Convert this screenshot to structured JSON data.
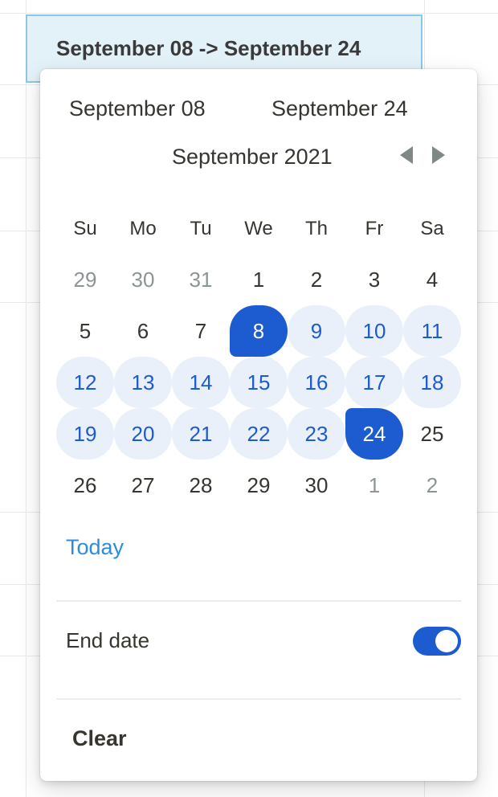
{
  "cell": {
    "value": "September 08 -> September 24"
  },
  "picker": {
    "range_start": "September 08",
    "range_end": "September 24",
    "month_label": "September 2021",
    "prev_icon": "triangle-left-icon",
    "next_icon": "triangle-right-icon",
    "weekdays": [
      "Su",
      "Mo",
      "Tu",
      "We",
      "Th",
      "Fr",
      "Sa"
    ],
    "weeks": [
      [
        "29",
        "30",
        "31",
        "1",
        "2",
        "3",
        "4"
      ],
      [
        "5",
        "6",
        "7",
        "8",
        "9",
        "10",
        "11"
      ],
      [
        "12",
        "13",
        "14",
        "15",
        "16",
        "17",
        "18"
      ],
      [
        "19",
        "20",
        "21",
        "22",
        "23",
        "24",
        "25"
      ],
      [
        "26",
        "27",
        "28",
        "29",
        "30",
        "1",
        "2"
      ]
    ],
    "today_label": "Today",
    "end_date_label": "End date",
    "end_date_enabled": true,
    "clear_label": "Clear"
  },
  "colors": {
    "accent": "#1d5bd1",
    "range_fill": "#eaf0fa",
    "today_link": "#2d8ce0",
    "cell_highlight": "#e3f1f8"
  }
}
